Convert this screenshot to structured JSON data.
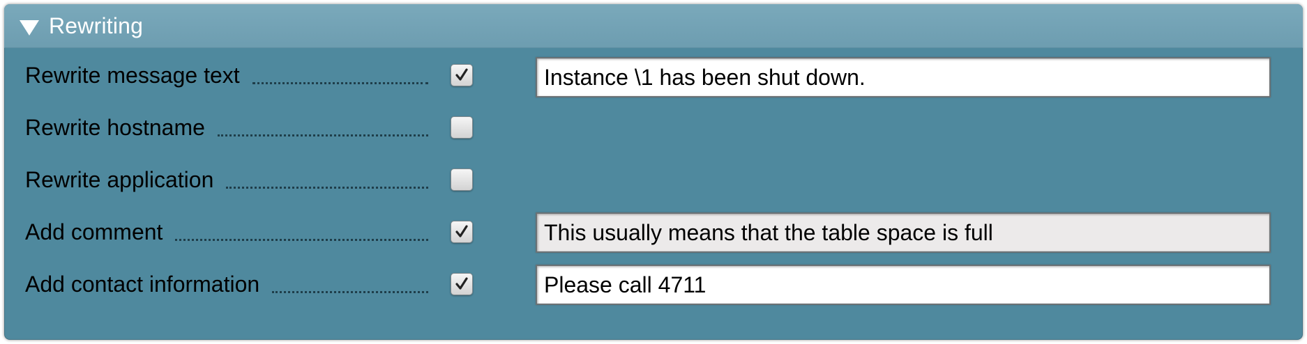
{
  "section": {
    "title": "Rewriting",
    "expanded_icon": "triangle-down-icon"
  },
  "rows": [
    {
      "label": "Rewrite message text",
      "checked": true,
      "value": "Instance \\1 has been shut down.",
      "field_state": "editable"
    },
    {
      "label": "Rewrite hostname",
      "checked": false
    },
    {
      "label": "Rewrite application",
      "checked": false
    },
    {
      "label": "Add comment",
      "checked": true,
      "value": "This usually means that the table space is full",
      "field_state": "readonly"
    },
    {
      "label": "Add contact information",
      "checked": true,
      "value": "Please call 4711",
      "field_state": "editable"
    }
  ],
  "colors": {
    "panel_background": "#4f899e",
    "header_background": "#72a2b5",
    "readonly_field": "#eceaea"
  }
}
